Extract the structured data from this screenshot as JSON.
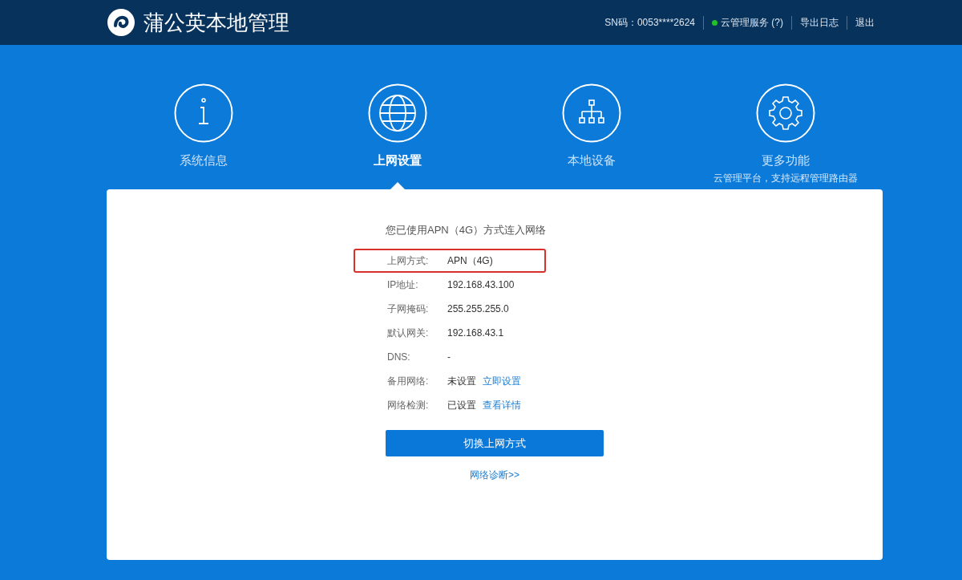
{
  "header": {
    "title": "蒲公英本地管理",
    "sn": "SN码：0053****2624",
    "service": {
      "label": "云管理服务 (?)",
      "color": "#22c02a"
    },
    "links": [
      "导出日志",
      "退出"
    ]
  },
  "nav": [
    {
      "kind": "info",
      "label": "系统信息",
      "selected": false
    },
    {
      "kind": "globe",
      "label": "上网设置",
      "selected": true
    },
    {
      "kind": "network",
      "label": "本地设备",
      "selected": false
    },
    {
      "kind": "gear",
      "label": "更多功能",
      "subtitle": "云管理平台，支持远程管理路由器",
      "selected": false
    }
  ],
  "panel": {
    "heading": "您已使用APN（4G）方式连入网络",
    "rows": [
      {
        "label": "上网方式:",
        "value": "APN（4G)",
        "highlighted": true
      },
      {
        "label": "IP地址:",
        "value": "192.168.43.100",
        "highlighted": false
      },
      {
        "label": "子网掩码:",
        "value": "255.255.255.0",
        "highlighted": false
      },
      {
        "label": "默认网关:",
        "value": "192.168.43.1",
        "highlighted": false
      },
      {
        "label": "DNS:",
        "value": "-",
        "highlighted": false
      },
      {
        "label": "备用网络:",
        "value": "未设置",
        "link": "立即设置",
        "highlighted": false
      },
      {
        "label": "网络检测:",
        "value": "已设置",
        "link": "查看详情",
        "highlighted": false
      }
    ],
    "button": "切换上网方式",
    "footer_link": "网络诊断>>"
  }
}
